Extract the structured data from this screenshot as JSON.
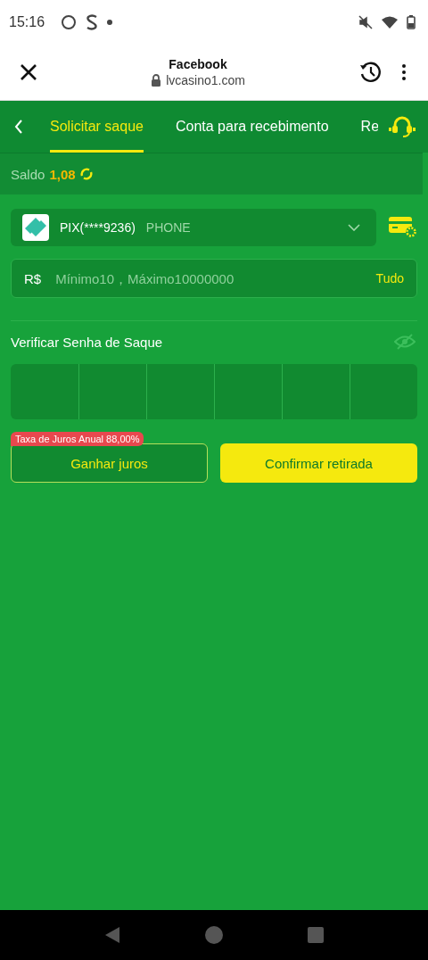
{
  "status_bar": {
    "time": "15:16"
  },
  "browser": {
    "title": "Facebook",
    "url": "lvcasino1.com"
  },
  "tabs": [
    {
      "label": "Solicitar saque",
      "selected": true
    },
    {
      "label": "Conta para recebimento",
      "selected": false
    },
    {
      "label": "Re",
      "selected": false
    }
  ],
  "balance": {
    "label": "Saldo",
    "amount": "1,08"
  },
  "account": {
    "name": "PIX(****9236)",
    "type": "PHONE"
  },
  "amount_field": {
    "currency": "R$",
    "placeholder": "Mínimo10，Máximo10000000",
    "all_button": "Tudo"
  },
  "password": {
    "label": "Verificar Senha de Saque"
  },
  "interest_badge": "Taxa de Juros Anual 88,00%",
  "buttons": [
    {
      "label": "Ganhar juros",
      "kind": "outline"
    },
    {
      "label": "Confirmar retirada",
      "kind": "primary"
    }
  ]
}
